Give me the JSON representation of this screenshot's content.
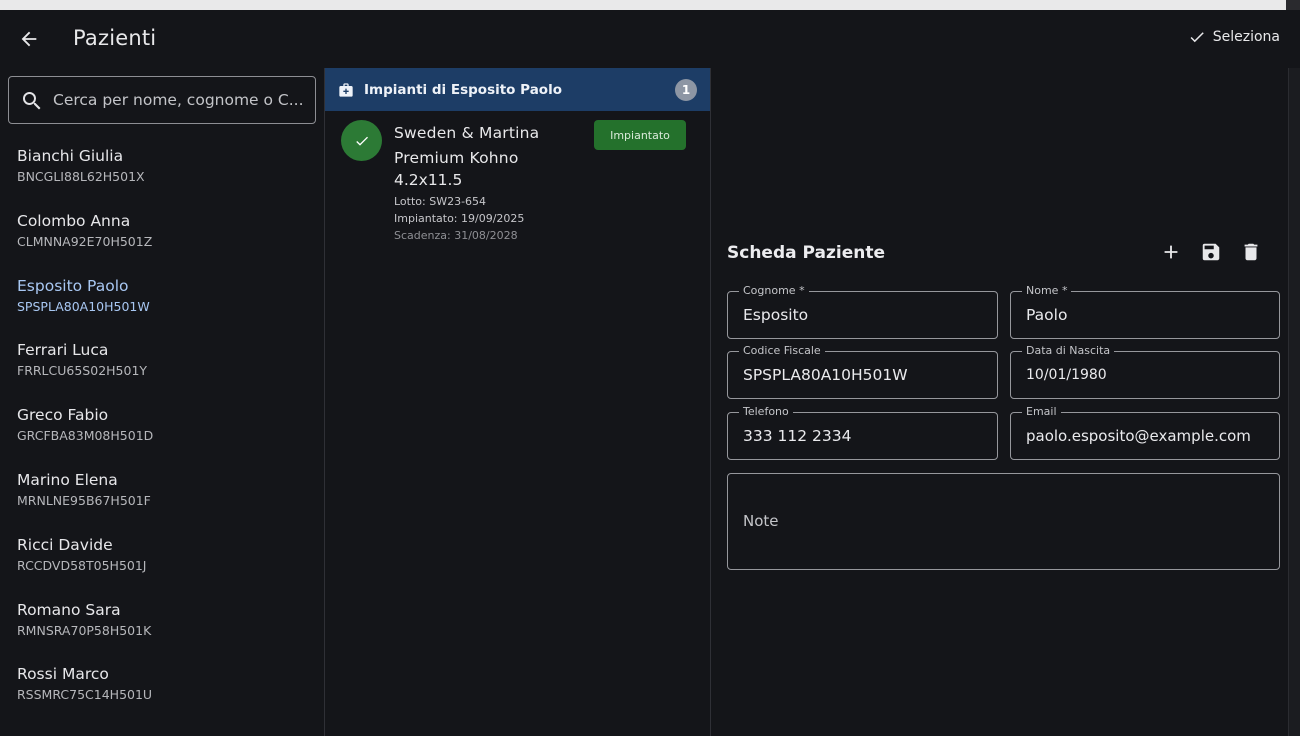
{
  "appbar": {
    "title": "Pazienti",
    "select_label": "Seleziona"
  },
  "search": {
    "placeholder": "Cerca per nome, cognome o C..."
  },
  "patients": [
    {
      "name": "Bianchi Giulia",
      "cf": "BNCGLI88L62H501X",
      "selected": false
    },
    {
      "name": "Colombo Anna",
      "cf": "CLMNNA92E70H501Z",
      "selected": false
    },
    {
      "name": "Esposito Paolo",
      "cf": "SPSPLA80A10H501W",
      "selected": true
    },
    {
      "name": "Ferrari Luca",
      "cf": "FRRLCU65S02H501Y",
      "selected": false
    },
    {
      "name": "Greco Fabio",
      "cf": "GRCFBA83M08H501D",
      "selected": false
    },
    {
      "name": "Marino Elena",
      "cf": "MRNLNE95B67H501F",
      "selected": false
    },
    {
      "name": "Ricci Davide",
      "cf": "RCCDVD58T05H501J",
      "selected": false
    },
    {
      "name": "Romano Sara",
      "cf": "RMNSRA70P58H501K",
      "selected": false
    },
    {
      "name": "Rossi Marco",
      "cf": "RSSMRC75C14H501U",
      "selected": false
    }
  ],
  "implants": {
    "header_title": "Impianti di Esposito Paolo",
    "count": "1",
    "items": [
      {
        "name": "Sweden & Martina Premium Kohno",
        "size": "4.2x11.5",
        "lotto": "Lotto: SW23-654",
        "implanted": "Impiantato: 19/09/2025",
        "expiry": "Scadenza: 31/08/2028",
        "status": "Impiantato"
      }
    ]
  },
  "form": {
    "title": "Scheda Paziente",
    "fields": {
      "cognome": {
        "label": "Cognome *",
        "value": "Esposito"
      },
      "nome": {
        "label": "Nome *",
        "value": "Paolo"
      },
      "codice_fiscale": {
        "label": "Codice Fiscale",
        "value": "SPSPLA80A10H501W"
      },
      "data_nascita": {
        "label": "Data di Nascita",
        "value": "10/01/1980"
      },
      "telefono": {
        "label": "Telefono",
        "value": "333 112 2334"
      },
      "email": {
        "label": "Email",
        "value": "paolo.esposito@example.com"
      }
    },
    "note_placeholder": "Note"
  },
  "colors": {
    "background": "#141519",
    "header_blue": "#1d3d66",
    "selected_text": "#a8c7f2",
    "status_green": "#24712c",
    "check_green": "#2c7a35"
  },
  "icons": {
    "back": "arrow-left-icon",
    "select": "check-icon",
    "search": "search-icon",
    "implants": "medical-kit-icon",
    "status_ok": "check-circle-icon",
    "add": "plus-icon",
    "save": "save-icon",
    "delete": "trash-icon"
  }
}
